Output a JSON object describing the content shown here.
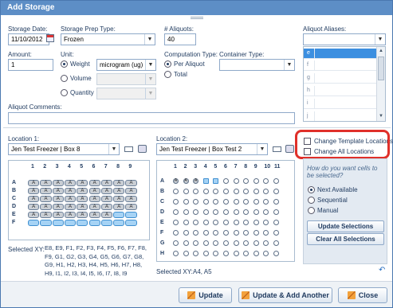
{
  "window": {
    "title": "Add Storage"
  },
  "form": {
    "storage_date_label": "Storage Date:",
    "storage_date_value": "11/10/2012",
    "prep_type_label": "Storage Prep Type:",
    "prep_type_value": "Frozen",
    "aliquots_label": "# Aliquots:",
    "aliquots_value": "40",
    "aliases_label": "Aliquot Aliases:",
    "amount_label": "Amount:",
    "amount_value": "1",
    "unit_label": "Unit:",
    "unit_weight": "Weight",
    "unit_volume": "Volume",
    "unit_quantity": "Quantity",
    "weight_unit_value": "microgram (ug)",
    "computation_label": "Computation Type:",
    "comp_per_aliquot": "Per Aliquot",
    "comp_total": "Total",
    "container_label": "Container Type:",
    "comments_label": "Aliquot Comments:"
  },
  "aliases": [
    "e",
    "f",
    "g",
    "h",
    "i",
    "j"
  ],
  "location1": {
    "label": "Location 1:",
    "value": "Jen Test Freezer | Box 8",
    "columns": [
      "1",
      "2",
      "3",
      "4",
      "5",
      "6",
      "7",
      "8",
      "9"
    ],
    "rows": [
      "A",
      "B",
      "C",
      "D",
      "E",
      "F"
    ],
    "used_label": "A",
    "selected_label": "Selected XY:",
    "selected_value": "E8, E9, F1, F2, F3, F4, F5, F6, F7, F8, F9, G1, G2, G3, G4, G5, G6, G7, G8, G9, H1, H2, H3, H4, H5, H6, H7, H8, H9, I1, I2, I3, I4, I5, I6, I7, I8, I9"
  },
  "location2": {
    "label": "Location 2:",
    "value": "Jen Test Freezer | Box Test 2",
    "columns": [
      "1",
      "2",
      "3",
      "4",
      "5",
      "6",
      "7",
      "8",
      "9",
      "10",
      "11"
    ],
    "rows": [
      "A",
      "B",
      "C",
      "D",
      "E",
      "F",
      "G",
      "H"
    ],
    "used_label": "A",
    "selected_label": "Selected XY:",
    "selected_value": "A4, A5"
  },
  "options": {
    "change_template": "Change Template Locations",
    "change_all": "Change All Locations",
    "question": "How do you want cells to be selected?",
    "next_available": "Next Available",
    "sequential": "Sequential",
    "manual": "Manual",
    "update_selections": "Update Selections",
    "clear_all": "Clear All Selections"
  },
  "buttons": {
    "update": "Update",
    "update_add": "Update & Add Another",
    "close": "Close"
  },
  "colors": {
    "title_bar": "#5d8ec6",
    "highlight": "#e0302a",
    "free_cell": "#a6d3f5",
    "used_cell": "#c9ced4"
  }
}
